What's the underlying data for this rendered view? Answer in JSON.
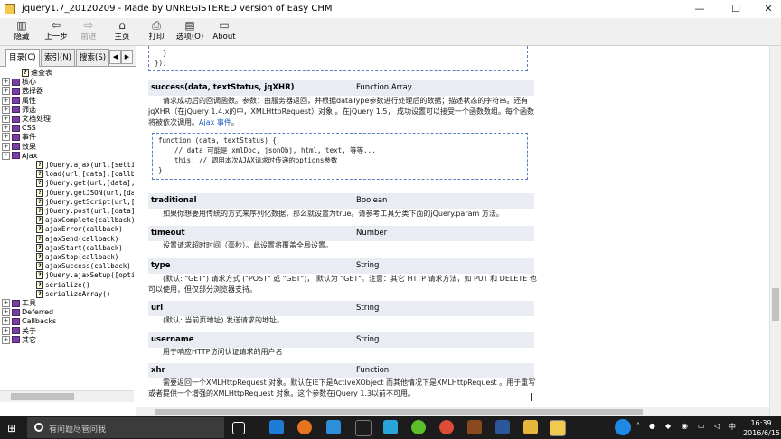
{
  "window": {
    "title": "jquery1.7_20120209 - Made by UNREGISTERED version of Easy CHM",
    "controls": {
      "minimize": "—",
      "maximize": "☐",
      "close": "✕"
    }
  },
  "toolbar": {
    "hide": "隐藏",
    "back": "上一步",
    "forward": "前进",
    "home": "主页",
    "print": "打印",
    "options": "选项(O)",
    "about": "About"
  },
  "left_tabs": {
    "contents": "目录(C)",
    "index": "索引(N)",
    "search": "搜索(S)"
  },
  "tree": [
    {
      "label": "速查表",
      "type": "page",
      "indent": 1
    },
    {
      "label": "核心",
      "type": "book",
      "indent": 0,
      "exp": "+"
    },
    {
      "label": "选择器",
      "type": "book",
      "indent": 0,
      "exp": "+"
    },
    {
      "label": "属性",
      "type": "book",
      "indent": 0,
      "exp": "+"
    },
    {
      "label": "筛选",
      "type": "book",
      "indent": 0,
      "exp": "+"
    },
    {
      "label": "文档处理",
      "type": "book",
      "indent": 0,
      "exp": "+"
    },
    {
      "label": "CSS",
      "type": "book",
      "indent": 0,
      "exp": "+"
    },
    {
      "label": "事件",
      "type": "book",
      "indent": 0,
      "exp": "+"
    },
    {
      "label": "效果",
      "type": "book",
      "indent": 0,
      "exp": "+"
    },
    {
      "label": "Ajax",
      "type": "book",
      "indent": 0,
      "exp": "-"
    },
    {
      "label": "jQuery.ajax(url,[setting",
      "type": "q",
      "indent": 2
    },
    {
      "label": "load(url,[data],[callbac",
      "type": "q",
      "indent": 2
    },
    {
      "label": "jQuery.get(url,[data],[c",
      "type": "q",
      "indent": 2
    },
    {
      "label": "jQuery.getJSON(url,[data",
      "type": "q",
      "indent": 2
    },
    {
      "label": "jQuery.getScript(url,[ca",
      "type": "q",
      "indent": 2
    },
    {
      "label": "jQuery.post(url,[data],[",
      "type": "q",
      "indent": 2
    },
    {
      "label": "ajaxComplete(callback)",
      "type": "q",
      "indent": 2
    },
    {
      "label": "ajaxError(callback)",
      "type": "q",
      "indent": 2
    },
    {
      "label": "ajaxSend(callback)",
      "type": "q",
      "indent": 2
    },
    {
      "label": "ajaxStart(callback)",
      "type": "q",
      "indent": 2
    },
    {
      "label": "ajaxStop(callback)",
      "type": "q",
      "indent": 2
    },
    {
      "label": "ajaxSuccess(callback)",
      "type": "q",
      "indent": 2
    },
    {
      "label": "jQuery.ajaxSetup([option",
      "type": "q",
      "indent": 2
    },
    {
      "label": "serialize()",
      "type": "q",
      "indent": 2
    },
    {
      "label": "serializeArray()",
      "type": "q",
      "indent": 2
    },
    {
      "label": "工具",
      "type": "book",
      "indent": 0,
      "exp": "+"
    },
    {
      "label": "Deferred",
      "type": "book",
      "indent": 0,
      "exp": "+"
    },
    {
      "label": "Callbacks",
      "type": "book",
      "indent": 0,
      "exp": "+"
    },
    {
      "label": "关于",
      "type": "book",
      "indent": 0,
      "exp": "+"
    },
    {
      "label": "其它",
      "type": "book",
      "indent": 0,
      "exp": "+"
    }
  ],
  "content": {
    "top_code": "  }\n});",
    "params": [
      {
        "name": "success(data, textStatus, jqXHR)",
        "type": "Function,Array",
        "desc": "请求成功后的回调函数。参数：由服务器返回，并根据dataType参数进行处理后的数据；描述状态的字符串。还有jqXHR（在jQuery 1.4.x的中，XMLHttpRequest）对象 。在jQuery 1.5， 成功设置可以接受一个函数数组。每个函数将被依次调用。",
        "link": "Ajax 事件",
        "link_suffix": "。"
      },
      {
        "name": "traditional",
        "type": "Boolean",
        "desc": "如果你想要用传统的方式来序列化数据，那么就设置为true。请参考工具分类下面的jQuery.param 方法。"
      },
      {
        "name": "timeout",
        "type": "Number",
        "desc": "设置请求超时时间（毫秒）。此设置将覆盖全局设置。"
      },
      {
        "name": "type",
        "type": "String",
        "desc": "(默认: \"GET\") 请求方式 (\"POST\" 或 \"GET\")， 默认为 \"GET\"。注意：其它 HTTP 请求方法，如 PUT 和 DELETE 也可以使用，但仅部分浏览器支持。"
      },
      {
        "name": "url",
        "type": "String",
        "desc": "(默认: 当前页地址) 发送请求的地址。"
      },
      {
        "name": "username",
        "type": "String",
        "desc": "用于响应HTTP访问认证请求的用户名"
      },
      {
        "name": "xhr",
        "type": "Function",
        "desc": "需要返回一个XMLHttpRequest 对象。默认在IE下是ActiveXObject 而其他情况下是XMLHttpRequest 。用于重写或者提供一个增强的XMLHttpRequest 对象。这个参数在jQuery 1.3以前不可用。"
      }
    ],
    "success_code": "function (data, textStatus) {\n    // data 可能是 xmlDoc, jsonObj, html, text, 等等...\n    this; // 调用本次AJAX请求时传递的options参数\n}"
  },
  "taskbar": {
    "search_placeholder": "有问题尽管问我",
    "time": "16:39",
    "date": "2016/6/15",
    "ime": "中"
  },
  "colors": {
    "accent": "#1a5cc4",
    "param_header": "#e9ecf3",
    "code_border": "#5b7fc7",
    "taskbar": "#1c1c1c"
  }
}
